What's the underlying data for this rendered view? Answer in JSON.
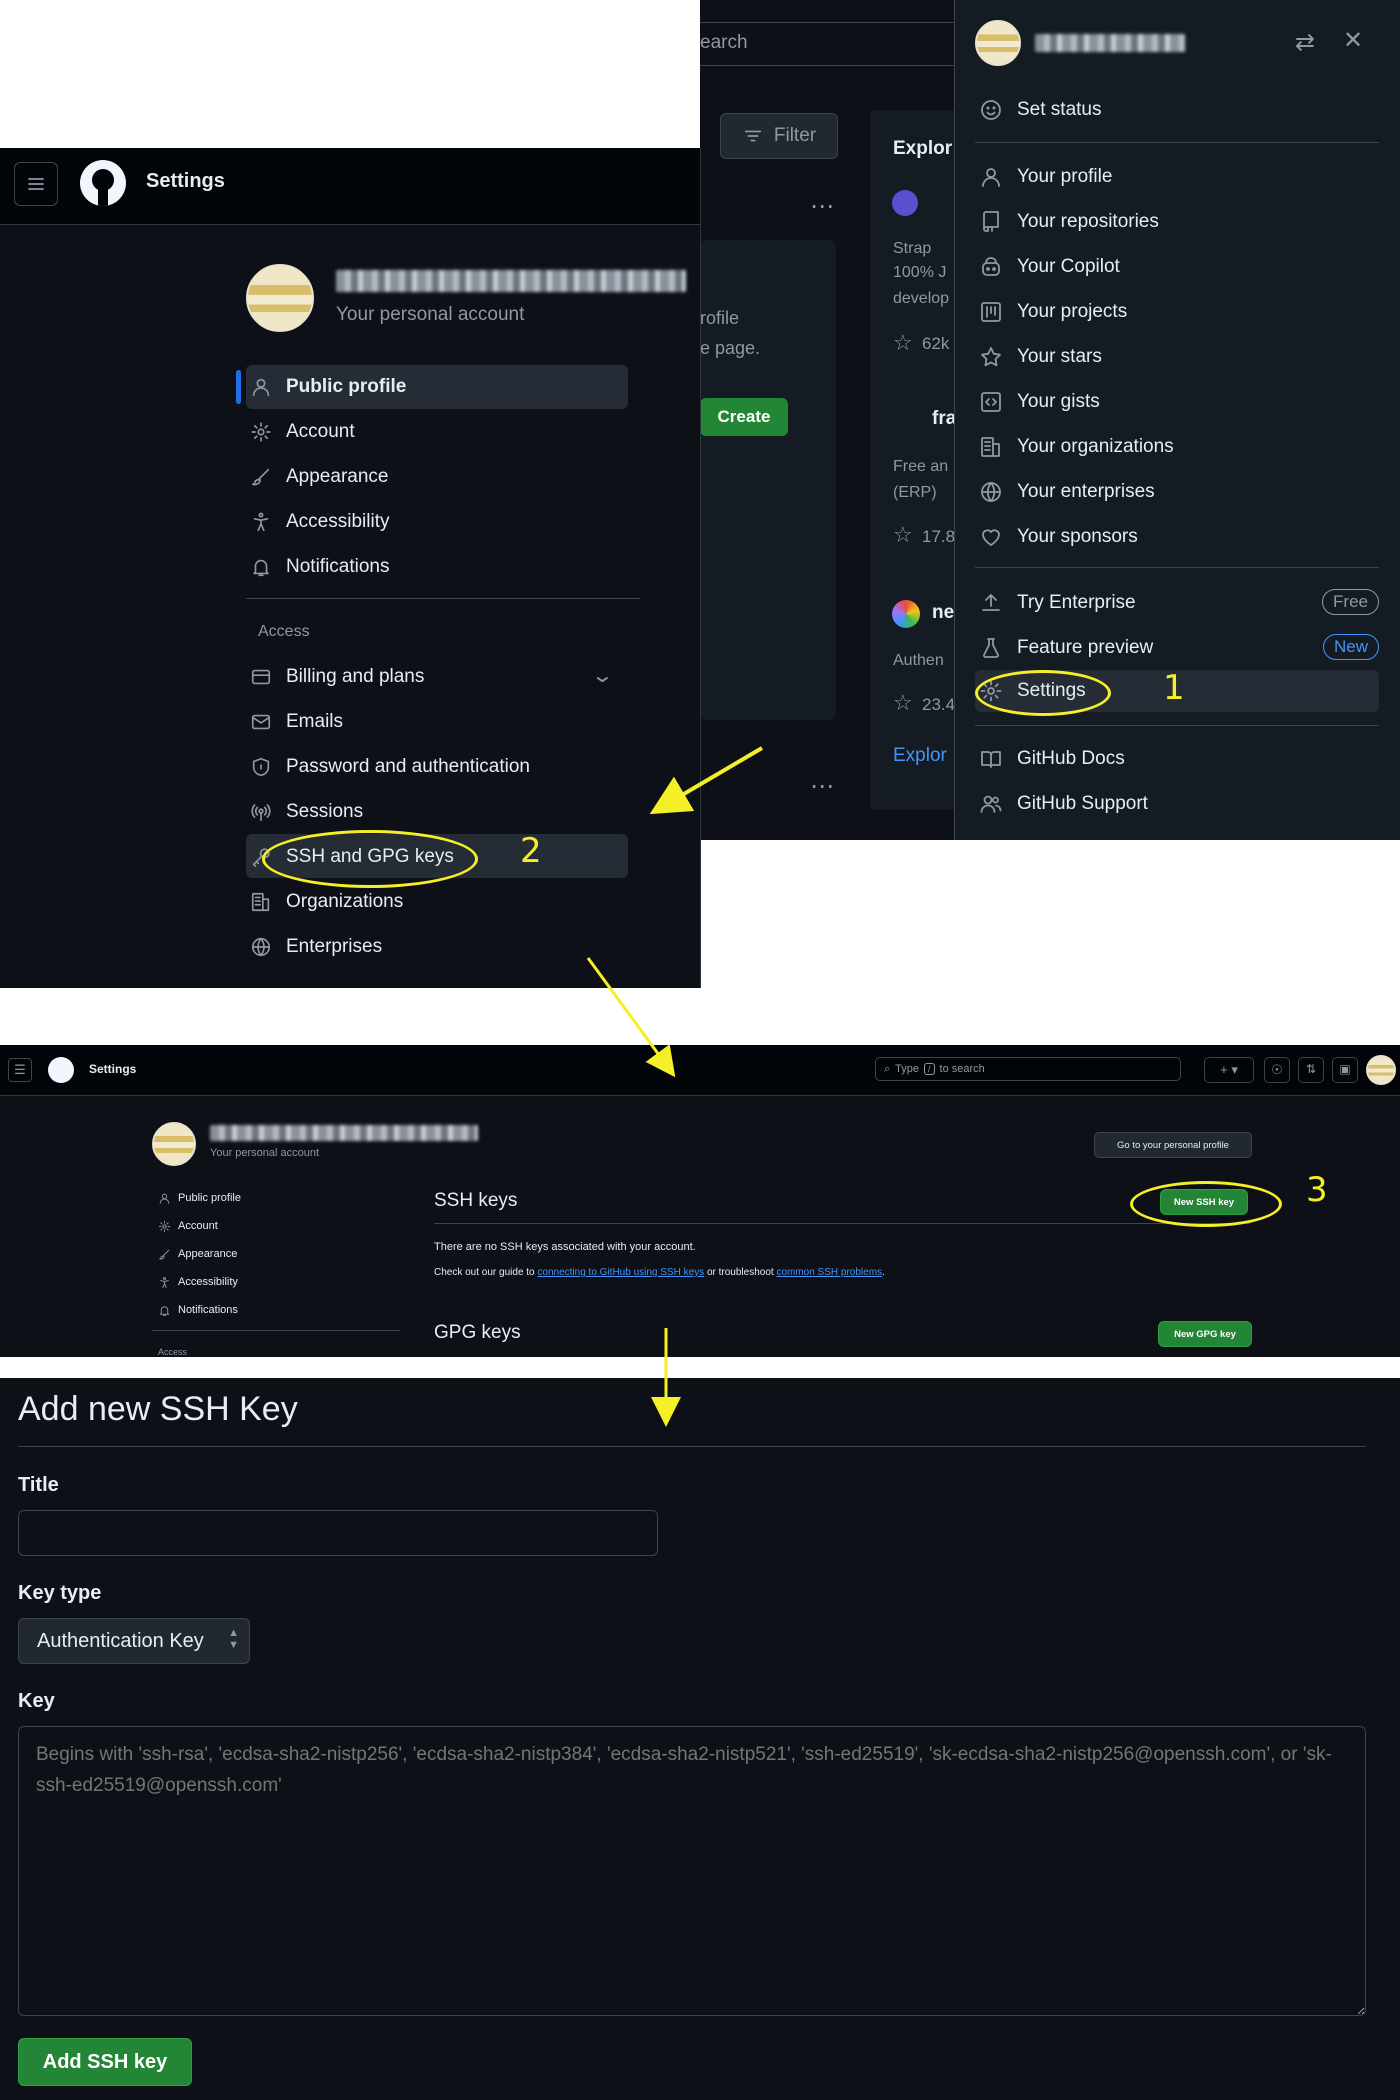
{
  "top_menu": {
    "search_fragment": "earch",
    "items_group1": [
      {
        "label": "Set status",
        "icon": "smiley-icon"
      }
    ],
    "items_group2": [
      {
        "label": "Your profile",
        "icon": "person-icon"
      },
      {
        "label": "Your repositories",
        "icon": "repo-icon"
      },
      {
        "label": "Your Copilot",
        "icon": "copilot-icon"
      },
      {
        "label": "Your projects",
        "icon": "project-icon"
      },
      {
        "label": "Your stars",
        "icon": "star-icon"
      },
      {
        "label": "Your gists",
        "icon": "code-square-icon"
      },
      {
        "label": "Your organizations",
        "icon": "organization-icon"
      },
      {
        "label": "Your enterprises",
        "icon": "globe-icon"
      },
      {
        "label": "Your sponsors",
        "icon": "heart-icon"
      }
    ],
    "try_enterprise": "Try Enterprise",
    "free_badge": "Free",
    "feature_preview": "Feature preview",
    "new_badge": "New",
    "settings": "Settings",
    "github_docs": "GitHub Docs",
    "github_support": "GitHub Support",
    "filter_label": "Filter",
    "explore_label": "Explor",
    "explore_link": "Explor",
    "create_label": "Create",
    "bg_texts": [
      "rofile",
      "e page.",
      "Strap",
      "100% J",
      "develop",
      "62k",
      "fra",
      "Free an",
      "(ERP)",
      "17.8",
      "ne",
      "Authen",
      "23.4"
    ]
  },
  "settings_panel": {
    "title": "Settings",
    "personal_account": "Your personal account",
    "nav": [
      {
        "label": "Public profile",
        "icon": "person-icon"
      },
      {
        "label": "Account",
        "icon": "gear-icon"
      },
      {
        "label": "Appearance",
        "icon": "paintbrush-icon"
      },
      {
        "label": "Accessibility",
        "icon": "accessibility-icon"
      },
      {
        "label": "Notifications",
        "icon": "bell-icon"
      }
    ],
    "access_heading": "Access",
    "access_nav": [
      {
        "label": "Billing and plans",
        "icon": "credit-card-icon"
      },
      {
        "label": "Emails",
        "icon": "mail-icon"
      },
      {
        "label": "Password and authentication",
        "icon": "shield-icon"
      },
      {
        "label": "Sessions",
        "icon": "broadcast-icon"
      },
      {
        "label": "SSH and GPG keys",
        "icon": "key-icon"
      },
      {
        "label": "Organizations",
        "icon": "organization-icon"
      },
      {
        "label": "Enterprises",
        "icon": "globe-icon"
      }
    ]
  },
  "ssh_page": {
    "header_title": "Settings",
    "search_placeholder_pre": "Type",
    "search_slash": "/",
    "search_placeholder_post": "to search",
    "personal_account": "Your personal account",
    "go_to_profile": "Go to your personal profile",
    "nav": [
      "Public profile",
      "Account",
      "Appearance",
      "Accessibility",
      "Notifications"
    ],
    "access_heading": "Access",
    "ssh_keys_heading": "SSH keys",
    "new_ssh_key": "New SSH key",
    "no_keys_text": "There are no SSH keys associated with your account.",
    "guide_pre": "Check out our guide to ",
    "guide_link1": "connecting to GitHub using SSH keys",
    "guide_mid": " or troubleshoot ",
    "guide_link2": "common SSH problems",
    "guide_end": ".",
    "gpg_keys_heading": "GPG keys",
    "new_gpg_key": "New GPG key"
  },
  "add_key_form": {
    "heading": "Add new SSH Key",
    "title_label": "Title",
    "title_value": "",
    "key_type_label": "Key type",
    "key_type_value": "Authentication Key",
    "key_label": "Key",
    "key_placeholder": "Begins with 'ssh-rsa', 'ecdsa-sha2-nistp256', 'ecdsa-sha2-nistp384', 'ecdsa-sha2-nistp521', 'ssh-ed25519', 'sk-ecdsa-sha2-nistp256@openssh.com', or 'sk-ssh-ed25519@openssh.com'",
    "submit": "Add SSH key"
  },
  "annotations": {
    "step1": "1",
    "step2": "2",
    "step3": "3",
    "highlight_color": "#f5ef27"
  },
  "colors": {
    "bg": "#0d1117",
    "panel_bg": "#151b23",
    "accent_blue": "#1f6feb",
    "button_green": "#238636",
    "link_blue": "#4493f8"
  }
}
